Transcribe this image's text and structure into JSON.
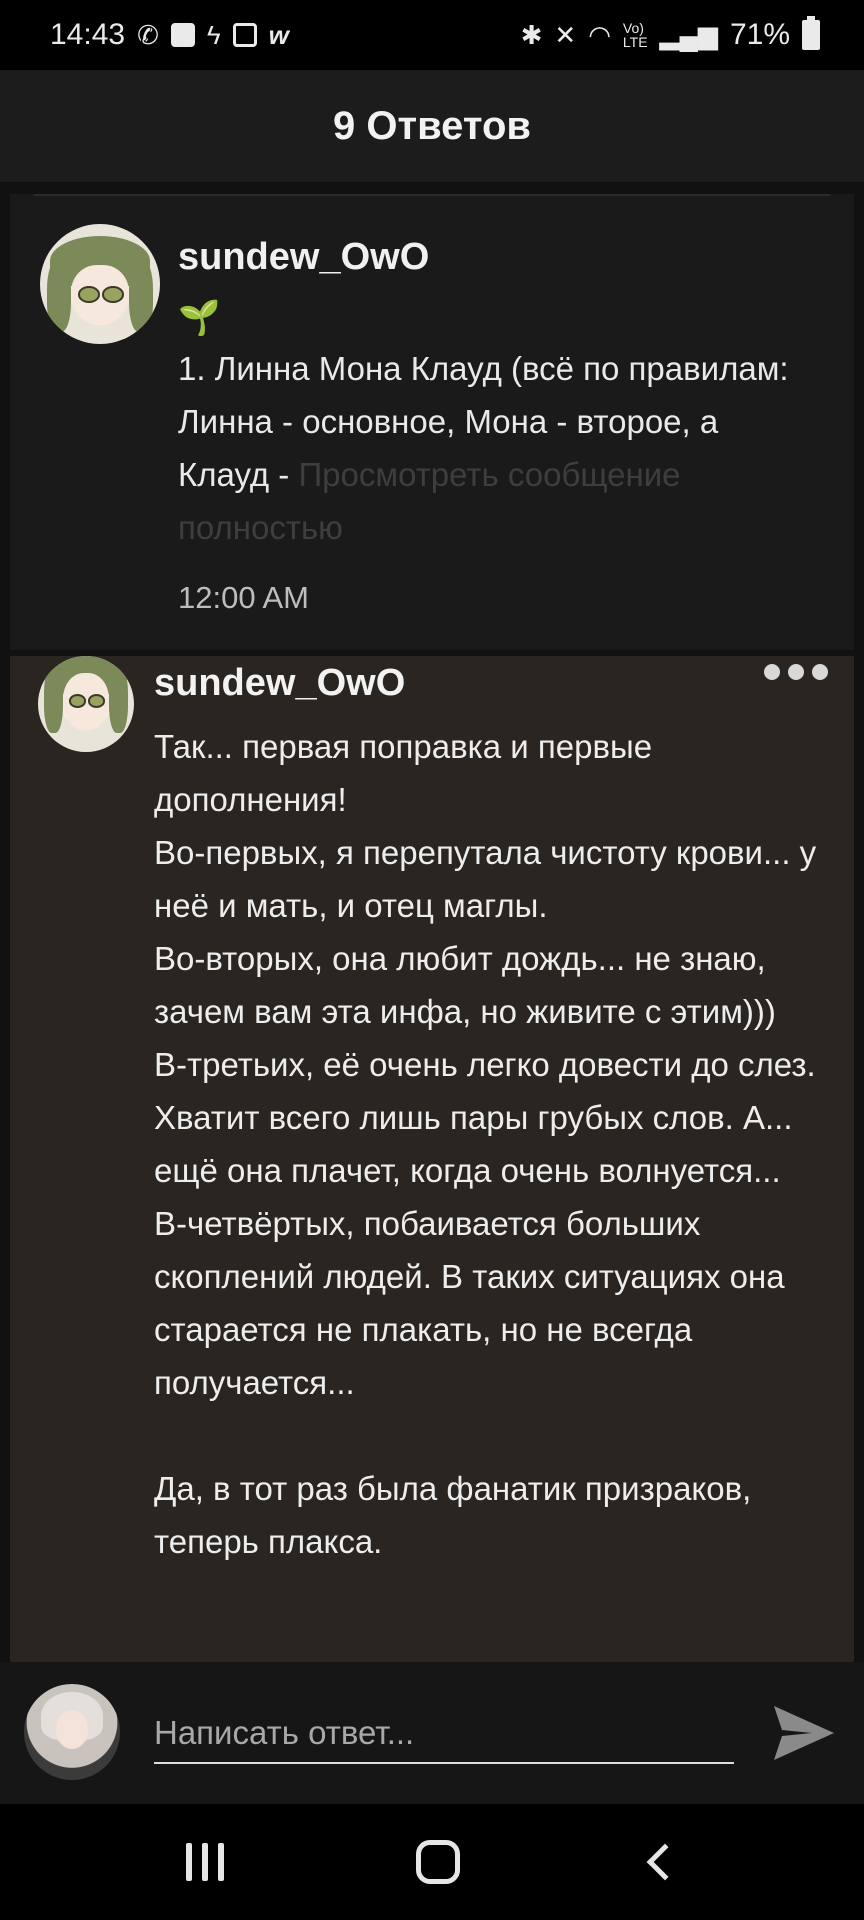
{
  "status_bar": {
    "time": "14:43",
    "battery": "71%",
    "left_icons": [
      "whatsapp-icon",
      "checkbox-icon",
      "lightning-icon",
      "image-icon",
      "w-app-icon"
    ],
    "right_icons": [
      "bluetooth-icon",
      "mute-icon",
      "wifi-icon",
      "volte-icon",
      "signal-icon",
      "battery-icon"
    ]
  },
  "header": {
    "title": "9 Ответов"
  },
  "parent_comment": {
    "username": "sundew_OwO",
    "emoji": "🌱",
    "text": "1. Линна Мона Клауд (всё по правилам: Линна - основное, Мона - второе, а Клауд -",
    "more_link": "Просмотреть сообщение полностью",
    "time": "12:00 AM"
  },
  "reply_comment": {
    "username": "sundew_OwO",
    "text": "Так... первая поправка и первые дополнения!\nВо-первых, я перепутала чистоту крови... у неё и мать, и отец маглы.\nВо-вторых, она любит дождь... не знаю, зачем вам эта инфа, но живите с этим)))\nВ-третьих, её очень легко довести до слез. Хватит всего лишь пары грубых слов. А... ещё она плачет, когда очень волнуется...\nВ-четвёртых, побаивается больших скоплений людей. В таких ситуациях она старается не плакать, но не всегда получается...\n\nДа, в тот раз была фанатик призраков, теперь плакса."
  },
  "reply_bar": {
    "placeholder": "Написать ответ..."
  },
  "colors": {
    "accent_sprout": "#5cbf3a",
    "reply_bg": "#2a2520",
    "card_bg": "#1a1a1a"
  }
}
